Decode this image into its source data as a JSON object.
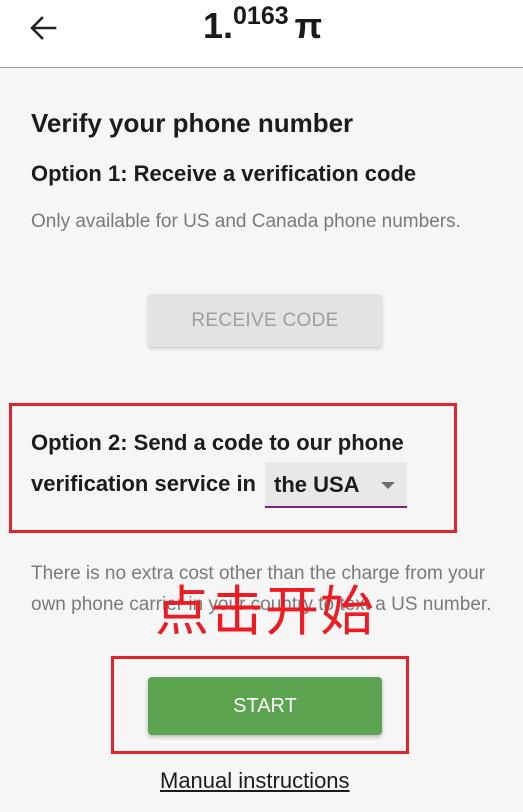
{
  "header": {
    "balance_main": "1.",
    "balance_decimals": "0163",
    "currency_symbol": "π",
    "back_icon": "arrow-left-icon"
  },
  "verify": {
    "title": "Verify your phone number",
    "option1": {
      "title": "Option 1: Receive a verification code",
      "description": "Only available for US and Canada phone numbers.",
      "button_label": "RECEIVE CODE"
    },
    "option2": {
      "title_line1": "Option 2: Send a code to our phone",
      "title_line2": "verification service in",
      "country_selected": "the USA",
      "description": "There is no extra cost other than the charge from your own phone carrier in your country to text a US number.",
      "button_label": "START"
    },
    "manual_link": "Manual instructions"
  },
  "annotation": {
    "overlay_text": "点击开始",
    "color": "#e0252b"
  },
  "colors": {
    "start_button": "#5ca44f",
    "select_underline": "#7a2577"
  }
}
